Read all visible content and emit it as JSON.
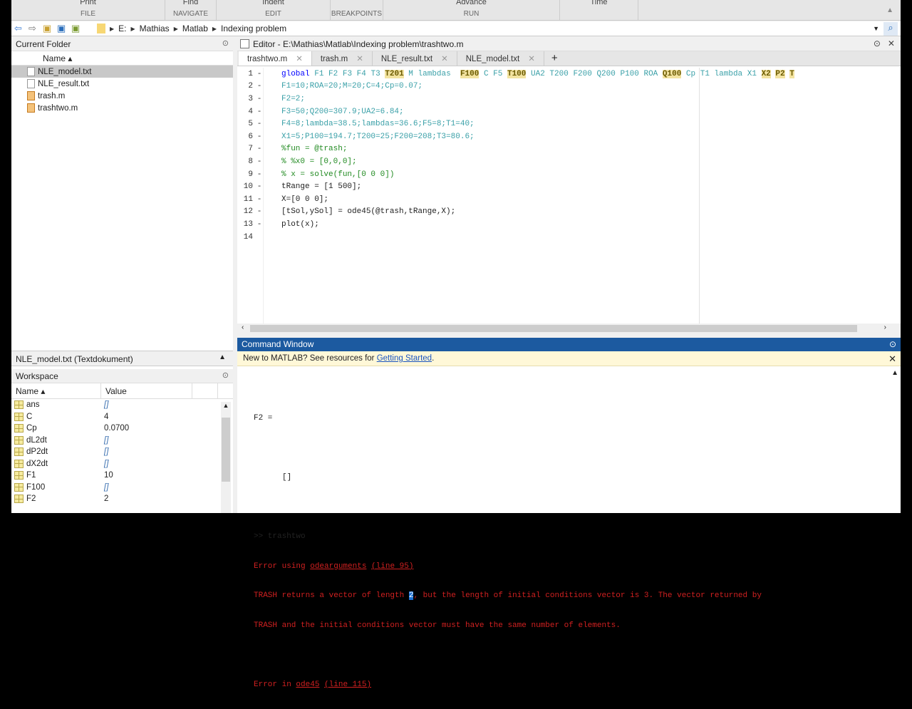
{
  "ribbon": {
    "sections": [
      {
        "top": "Print",
        "label": "FILE"
      },
      {
        "top": "Find",
        "label": "NAVIGATE"
      },
      {
        "top": "Indent",
        "label": "EDIT"
      },
      {
        "top": "",
        "label": "BREAKPOINTS"
      },
      {
        "top": "Advance",
        "label": "RUN"
      },
      {
        "top": "Time",
        "label": ""
      }
    ]
  },
  "address": {
    "crumbs": [
      "E:",
      "Mathias",
      "Matlab",
      "Indexing problem"
    ]
  },
  "current_folder": {
    "title": "Current Folder",
    "column": "Name ▴",
    "files": [
      {
        "name": "NLE_model.txt",
        "type": "txt",
        "selected": true
      },
      {
        "name": "NLE_result.txt",
        "type": "txt"
      },
      {
        "name": "trash.m",
        "type": "m"
      },
      {
        "name": "trashtwo.m",
        "type": "m"
      }
    ]
  },
  "details": {
    "label": "NLE_model.txt  (Textdokument)"
  },
  "workspace": {
    "title": "Workspace",
    "col_name": "Name ▴",
    "col_value": "Value",
    "vars": [
      {
        "name": "ans",
        "value": "[]",
        "empty": true
      },
      {
        "name": "C",
        "value": "4"
      },
      {
        "name": "Cp",
        "value": "0.0700"
      },
      {
        "name": "dL2dt",
        "value": "[]",
        "empty": true
      },
      {
        "name": "dP2dt",
        "value": "[]",
        "empty": true
      },
      {
        "name": "dX2dt",
        "value": "[]",
        "empty": true
      },
      {
        "name": "F1",
        "value": "10"
      },
      {
        "name": "F100",
        "value": "[]",
        "empty": true
      },
      {
        "name": "F2",
        "value": "2"
      }
    ]
  },
  "editor": {
    "title": "Editor - E:\\Mathias\\Matlab\\Indexing problem\\trashtwo.m",
    "tabs": [
      "trashtwo.m",
      "trash.m",
      "NLE_result.txt",
      "NLE_model.txt"
    ],
    "active_tab": 0,
    "global_line": {
      "keyword": "global",
      "vars": [
        [
          "F1",
          0
        ],
        [
          "F2",
          0
        ],
        [
          "F3",
          0
        ],
        [
          "F4",
          0
        ],
        [
          "T3",
          0
        ],
        [
          "T201",
          1
        ],
        [
          "M",
          0
        ],
        [
          "lambdas ",
          0
        ],
        [
          "F100",
          1
        ],
        [
          "C",
          0
        ],
        [
          "F5",
          0
        ],
        [
          "T100",
          1
        ],
        [
          "UA2",
          0
        ],
        [
          "T200",
          0
        ],
        [
          "F200",
          0
        ],
        [
          "Q200",
          0
        ],
        [
          "P100",
          0
        ],
        [
          "ROA",
          0
        ],
        [
          "Q100",
          1
        ],
        [
          "Cp",
          0
        ],
        [
          "T1",
          0
        ],
        [
          "lambda",
          0
        ],
        [
          "X1",
          0
        ],
        [
          "X2",
          1
        ],
        [
          "P2",
          1
        ],
        [
          "T",
          1
        ]
      ]
    },
    "lines": [
      {
        "n": "2",
        "text": "F1=10;ROA=20;M=20;C=4;Cp=0.07;",
        "t": "gv"
      },
      {
        "n": "3",
        "text": "F2=2;",
        "t": "gv"
      },
      {
        "n": "4",
        "text": "F3=50;Q200=307.9;UA2=6.84;",
        "t": "gv"
      },
      {
        "n": "5",
        "text": "F4=8;lambda=38.5;lambdas=36.6;F5=8;T1=40;",
        "t": "gv"
      },
      {
        "n": "6",
        "text": "X1=5;P100=194.7;T200=25;F200=208;T3=80.6;",
        "t": "gv"
      },
      {
        "n": "7",
        "text": "%fun = @trash;",
        "t": "cm"
      },
      {
        "n": "8",
        "text": "% %x0 = [0,0,0];",
        "t": "cm"
      },
      {
        "n": "9",
        "text": "% x = solve(fun,[0 0 0])",
        "t": "cm"
      },
      {
        "n": "10",
        "text": "tRange = [1 500];",
        "t": "pl"
      },
      {
        "n": "11",
        "text": "X=[0 0 0];",
        "t": "pl"
      },
      {
        "n": "12",
        "text": "[tSol,ySol] = ode45(@trash,tRange,X);",
        "t": "pl"
      },
      {
        "n": "13",
        "text": "plot(x);",
        "t": "pl"
      },
      {
        "n": "14",
        "text": "",
        "t": "pl"
      }
    ]
  },
  "command_window": {
    "title": "Command Window",
    "notice": "New to MATLAB? See resources for ",
    "notice_link": "Getting Started",
    "notice_end": ".",
    "out": {
      "f2": "F2 =",
      "empty": "[]",
      "prompt": ">> trashtwo",
      "e1a": "Error using ",
      "e1link": "odearguments",
      "e1b": " ",
      "e1line": "(line 95)",
      "e2a": "TRASH returns a vector of length ",
      "e2sel": "2",
      "e2b": ", but the length of initial conditions vector is 3. The vector returned by",
      "e3": "TRASH and the initial conditions vector must have the same number of elements.",
      "e4a": "Error in ",
      "e4link": "ode45",
      "e4line": "(line 115)"
    }
  }
}
